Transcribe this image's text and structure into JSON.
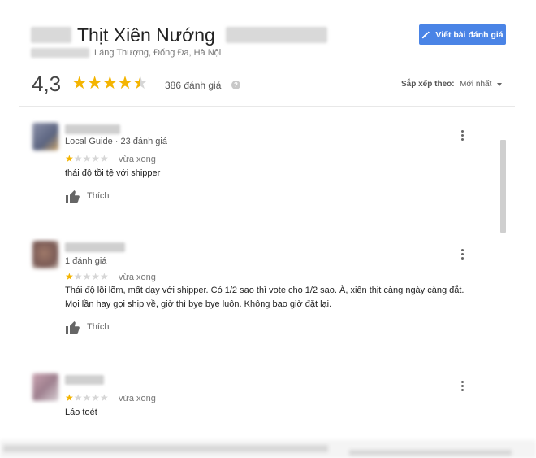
{
  "place": {
    "name": "Thịt Xiên Nướng",
    "address": "Láng Thượng, Đống Đa, Hà Nội",
    "rating": "4,3",
    "rating_value": 4.3,
    "review_count": "386 đánh giá",
    "help_icon": "?"
  },
  "actions": {
    "write_review": "Viết bài đánh giá",
    "sort_label": "Sắp xếp theo:",
    "sort_value": "Mới nhất"
  },
  "colors": {
    "accent_blue": "#4a84e6",
    "star_yellow": "#f4b400",
    "star_grey": "#d6d6d6"
  },
  "reviews": [
    {
      "meta": "Local Guide · 23 đánh giá",
      "stars": "★☆☆☆☆",
      "rating": 1,
      "time": "vừa xong",
      "text_line1": "thái độ tồi tệ với shipper",
      "text_line2": "",
      "like_label": "Thích"
    },
    {
      "meta": "1 đánh giá",
      "stars": "★☆☆☆☆",
      "rating": 1,
      "time": "vừa xong",
      "text_line1": "Thái độ lồi lõm, mất dạy với shipper. Có 1/2 sao thì vote cho 1/2 sao.  À, xiên thịt càng ngày càng đắt.",
      "text_line2": "Mọi lần hay gọi ship về, giờ thì bye bye luôn. Không bao giờ đặt lại.",
      "like_label": "Thích"
    },
    {
      "meta": "",
      "stars": "★☆☆☆☆",
      "rating": 1,
      "time": "vừa xong",
      "text_line1": "Láo toét",
      "text_line2": "",
      "like_label": ""
    }
  ]
}
